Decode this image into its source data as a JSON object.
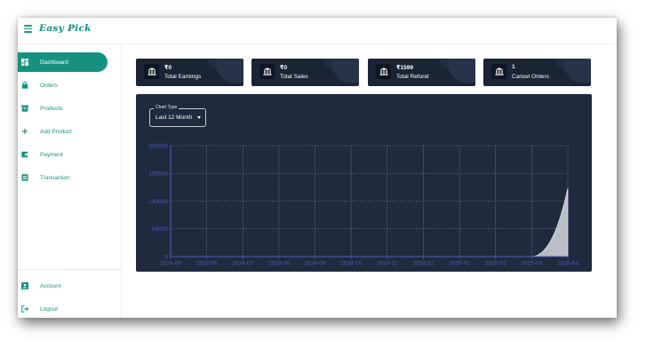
{
  "app": {
    "logo": "Easy Pick"
  },
  "sidebar": {
    "items": [
      {
        "label": "Dashboard",
        "icon": "dashboard-icon",
        "active": true
      },
      {
        "label": "Orders",
        "icon": "bag-icon",
        "active": false
      },
      {
        "label": "Products",
        "icon": "archive-box-icon",
        "active": false
      },
      {
        "label": "Add Product",
        "icon": "plus-icon",
        "active": false
      },
      {
        "label": "Payment",
        "icon": "wallet-icon",
        "active": false
      },
      {
        "label": "Transaction",
        "icon": "list-icon",
        "active": false
      }
    ],
    "bottom_items": [
      {
        "label": "Account",
        "icon": "account-icon"
      },
      {
        "label": "Logout",
        "icon": "logout-icon"
      }
    ]
  },
  "cards": [
    {
      "value": "₹0",
      "label": "Total Earnings",
      "icon": "bank-icon"
    },
    {
      "value": "₹0",
      "label": "Total Sales",
      "icon": "bank-icon"
    },
    {
      "value": "₹1599",
      "label": "Total Refund",
      "icon": "bank-icon"
    },
    {
      "value": "1",
      "label": "Cancel Orders",
      "icon": "bank-icon"
    }
  ],
  "chart_filter": {
    "legend": "Chart Type",
    "value": "Last 12 Month"
  },
  "chart_data": {
    "type": "area",
    "x": [
      "2024-05",
      "2024-06",
      "2024-07",
      "2024-08",
      "2024-09",
      "2024-10",
      "2024-11",
      "2024-12",
      "2025-01",
      "2025-02",
      "2025-03",
      "2025-04"
    ],
    "values": [
      0,
      0,
      0,
      0,
      0,
      0,
      0,
      0,
      0,
      0,
      0,
      160000
    ],
    "yticks": [
      "0",
      "65000",
      "130000",
      "195000",
      "260000"
    ],
    "ylim": [
      0,
      260000
    ],
    "grid": true,
    "colors": {
      "area": "#b9bec7",
      "grid": "#7d879b",
      "axis": "#4f5db0",
      "tick_text": "#4f5db0"
    }
  },
  "colors": {
    "accent": "#16917f",
    "card_bg": "#1b2435",
    "panel_bg": "#1f2a3f"
  }
}
